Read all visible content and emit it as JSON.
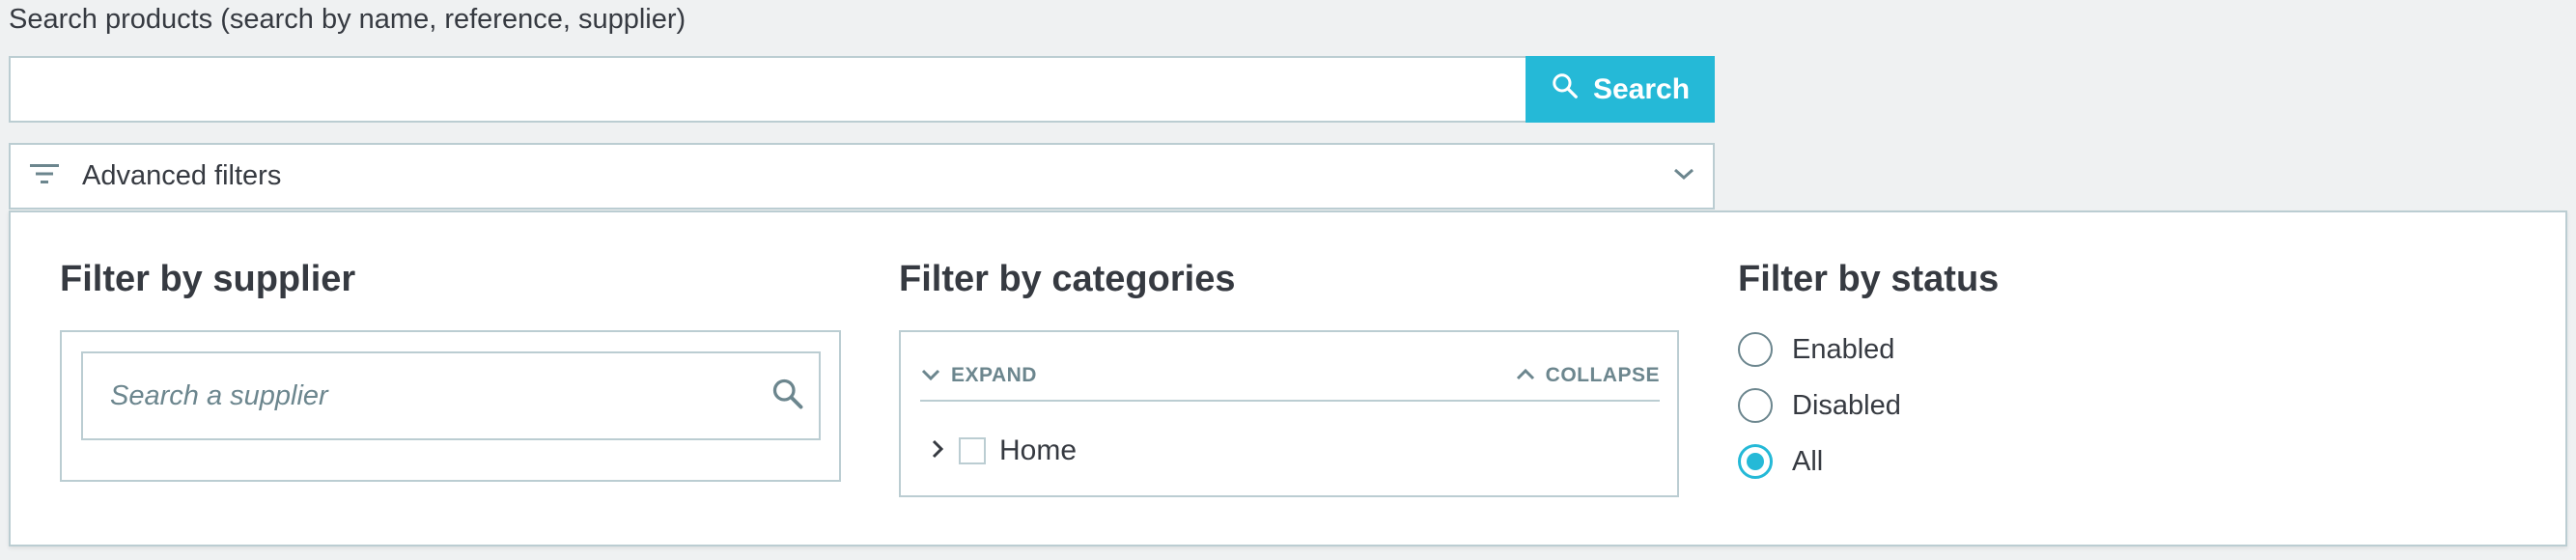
{
  "search": {
    "label": "Search products (search by name, reference, supplier)",
    "value": "",
    "button_label": "Search",
    "button_icon": "search-icon"
  },
  "advanced_filters": {
    "label": "Advanced filters",
    "icon": "filter-icon",
    "toggle_icon": "chevron-down-icon"
  },
  "supplier_filter": {
    "title": "Filter by supplier",
    "placeholder": "Search a supplier"
  },
  "category_filter": {
    "title": "Filter by categories",
    "expand_label": "EXPAND",
    "collapse_label": "COLLAPSE",
    "tree": [
      {
        "label": "Home",
        "checked": false,
        "expanded": false
      }
    ]
  },
  "status_filter": {
    "title": "Filter by status",
    "options": [
      {
        "label": "Enabled",
        "checked": false
      },
      {
        "label": "Disabled",
        "checked": false
      },
      {
        "label": "All",
        "checked": true
      }
    ]
  },
  "colors": {
    "accent": "#25b9d7",
    "border": "#bbcdd2",
    "text": "#363a41",
    "muted": "#6c868e",
    "background": "#eff1f2"
  }
}
